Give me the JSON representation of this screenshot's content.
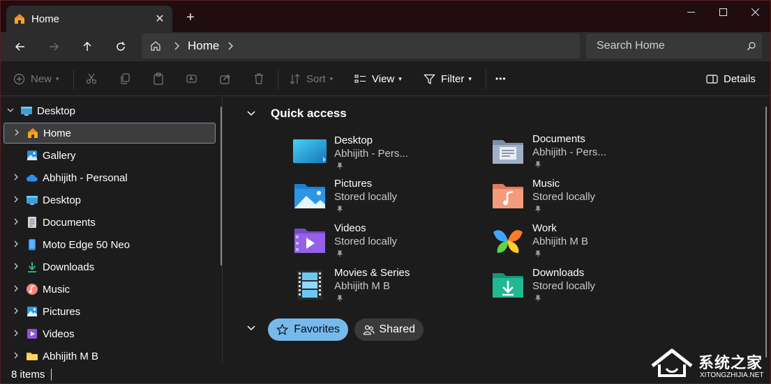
{
  "tab": {
    "title": "Home",
    "close": "✕",
    "new_tab": "+"
  },
  "window_controls": {
    "minimize": "—",
    "maximize": "☐",
    "close": "✕"
  },
  "nav": {
    "back": "←",
    "forward": "→",
    "up": "↑",
    "refresh": "↻",
    "breadcrumb": [
      "Home"
    ],
    "search_placeholder": "Search Home"
  },
  "toolbar": {
    "new": "New",
    "sort": "Sort",
    "view": "View",
    "filter": "Filter",
    "more": "•••",
    "details": "Details"
  },
  "sidebar": {
    "items": [
      {
        "label": "Desktop",
        "icon": "desktop-icon",
        "expander": "⌄",
        "indent": 0,
        "selected": false
      },
      {
        "label": "Home",
        "icon": "home-icon",
        "expander": "›",
        "indent": 1,
        "selected": true
      },
      {
        "label": "Gallery",
        "icon": "gallery-icon",
        "expander": "",
        "indent": 1,
        "selected": false
      },
      {
        "label": "Abhijith - Personal",
        "icon": "onedrive-icon",
        "expander": "›",
        "indent": 1,
        "selected": false
      },
      {
        "label": "Desktop",
        "icon": "desktop-icon",
        "expander": "›",
        "indent": 1,
        "selected": false
      },
      {
        "label": "Documents",
        "icon": "documents-icon",
        "expander": "›",
        "indent": 1,
        "selected": false
      },
      {
        "label": "Moto Edge 50 Neo",
        "icon": "phone-icon",
        "expander": "›",
        "indent": 1,
        "selected": false
      },
      {
        "label": "Downloads",
        "icon": "downloads-icon",
        "expander": "›",
        "indent": 1,
        "selected": false
      },
      {
        "label": "Music",
        "icon": "music-icon",
        "expander": "›",
        "indent": 1,
        "selected": false
      },
      {
        "label": "Pictures",
        "icon": "pictures-icon",
        "expander": "›",
        "indent": 1,
        "selected": false
      },
      {
        "label": "Videos",
        "icon": "videos-icon",
        "expander": "›",
        "indent": 1,
        "selected": false
      },
      {
        "label": "Abhijith M B",
        "icon": "folder-icon",
        "expander": "›",
        "indent": 1,
        "selected": false
      }
    ]
  },
  "quick_access": {
    "title": "Quick access",
    "items": [
      {
        "name": "Desktop",
        "sub": "Abhijith - Pers...",
        "icon": "desktop-folder-icon"
      },
      {
        "name": "Documents",
        "sub": "Abhijith - Pers...",
        "icon": "documents-folder-icon"
      },
      {
        "name": "Pictures",
        "sub": "Stored locally",
        "icon": "pictures-folder-icon"
      },
      {
        "name": "Music",
        "sub": "Stored locally",
        "icon": "music-folder-icon"
      },
      {
        "name": "Videos",
        "sub": "Stored locally",
        "icon": "videos-folder-icon"
      },
      {
        "name": "Work",
        "sub": "Abhijith M B",
        "icon": "work-folder-icon"
      },
      {
        "name": "Movies & Series",
        "sub": "Abhijith M B",
        "icon": "film-folder-icon"
      },
      {
        "name": "Downloads",
        "sub": "Stored locally",
        "icon": "downloads-folder-icon"
      }
    ]
  },
  "chips": {
    "favorites": "Favorites",
    "shared": "Shared"
  },
  "status": {
    "items": "8 items"
  },
  "watermark": {
    "brand": "系统之家",
    "url": "XITONGZHIJIA.NET"
  }
}
